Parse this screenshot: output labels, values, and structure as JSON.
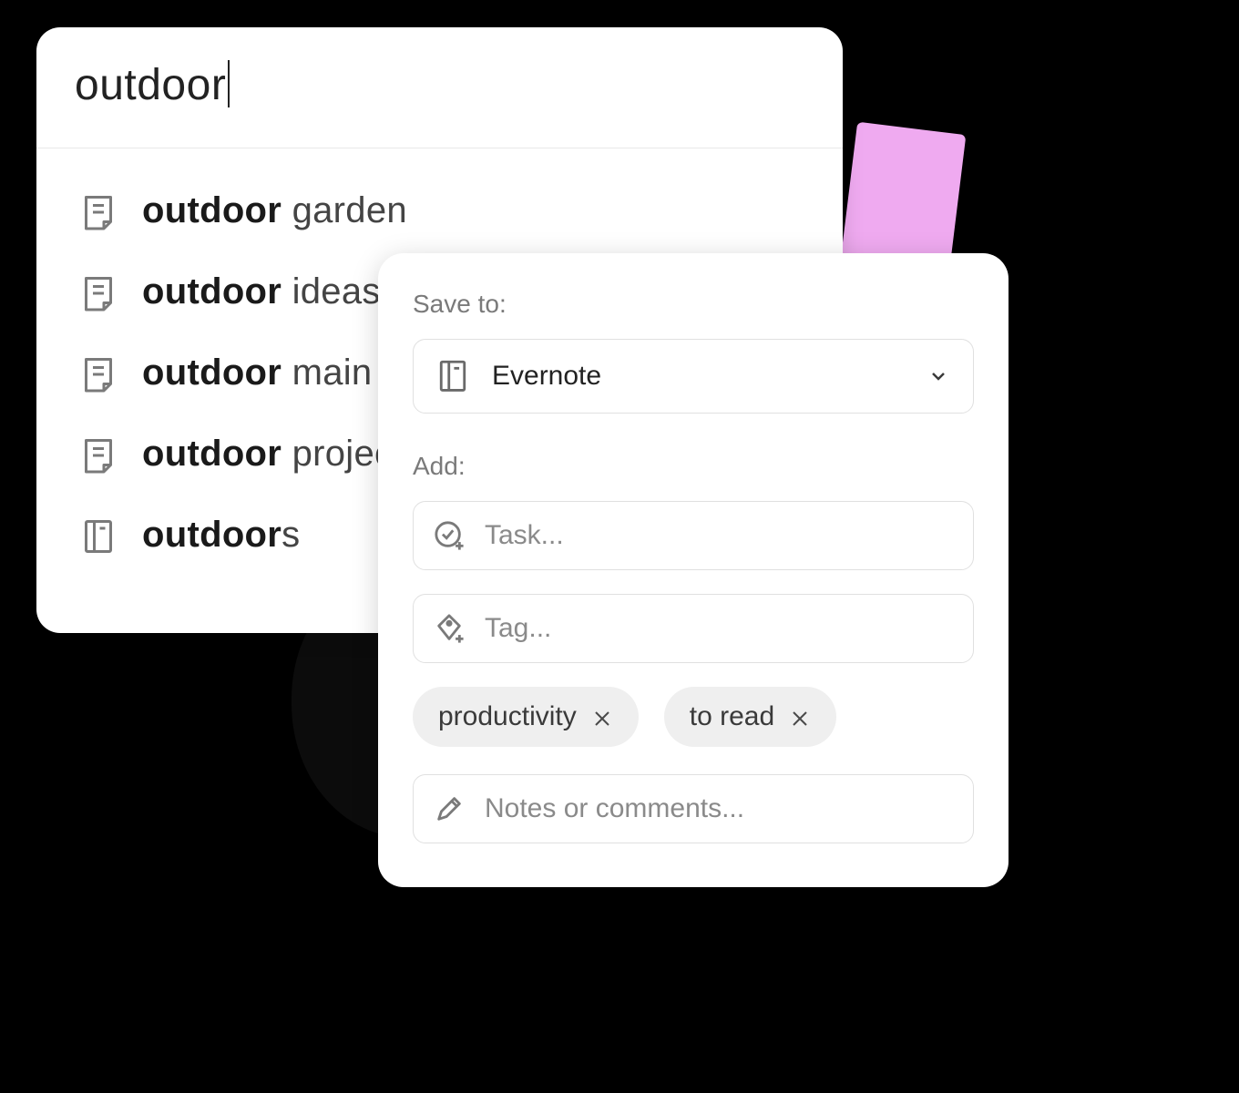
{
  "search": {
    "query": "outdoor",
    "results": [
      {
        "icon": "note",
        "prefix": "outdoor",
        "rest": " garden"
      },
      {
        "icon": "note",
        "prefix": "outdoor",
        "rest": " ideas"
      },
      {
        "icon": "note",
        "prefix": "outdoor",
        "rest": " main p"
      },
      {
        "icon": "note",
        "prefix": "outdoor",
        "rest": " projec"
      },
      {
        "icon": "notebook",
        "prefix": "outdoor",
        "rest": "s"
      }
    ]
  },
  "save_panel": {
    "save_to_label": "Save to:",
    "notebook": "Evernote",
    "add_label": "Add:",
    "task_placeholder": "Task...",
    "tag_placeholder": "Tag...",
    "tags": [
      {
        "label": "productivity"
      },
      {
        "label": "to read"
      }
    ],
    "notes_placeholder": "Notes or comments..."
  }
}
